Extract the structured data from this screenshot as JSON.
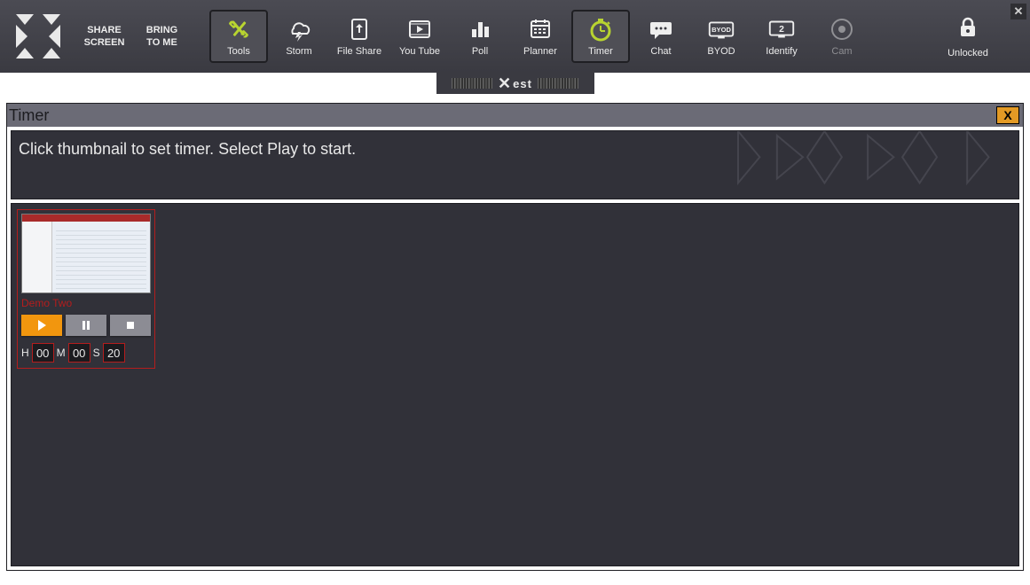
{
  "toolbar": {
    "share_screen_line1": "SHARE",
    "share_screen_line2": "SCREEN",
    "bring_line1": "BRING",
    "bring_line2": "TO ME",
    "close_label": "✕",
    "items": [
      {
        "label": "Tools",
        "icon": "tools-icon",
        "active": true
      },
      {
        "label": "Storm",
        "icon": "storm-icon"
      },
      {
        "label": "File Share",
        "icon": "file-share-icon"
      },
      {
        "label": "You Tube",
        "icon": "youtube-icon"
      },
      {
        "label": "Poll",
        "icon": "poll-icon"
      },
      {
        "label": "Planner",
        "icon": "planner-icon"
      },
      {
        "label": "Timer",
        "icon": "timer-icon",
        "active": true,
        "highlight": true
      },
      {
        "label": "Chat",
        "icon": "chat-icon"
      },
      {
        "label": "BYOD",
        "icon": "byod-icon"
      },
      {
        "label": "Identify",
        "icon": "identify-icon"
      },
      {
        "label": "Cam",
        "icon": "cam-icon",
        "disabled": true
      }
    ],
    "lock_label": "Unlocked"
  },
  "gripper": {
    "brand": "est"
  },
  "panel": {
    "title": "Timer",
    "close_label": "X",
    "instruction": "Click thumbnail to set timer. Select Play to start."
  },
  "card": {
    "name": "Demo Two",
    "h_label": "H",
    "m_label": "M",
    "s_label": "S",
    "hours": "00",
    "minutes": "00",
    "seconds": "20"
  }
}
